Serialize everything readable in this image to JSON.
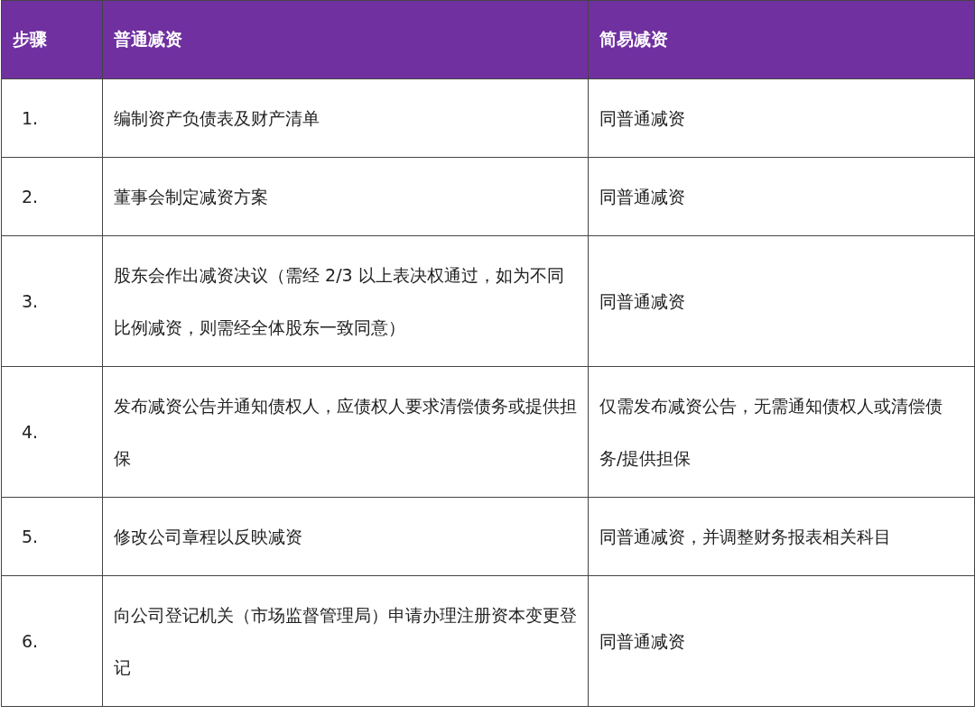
{
  "table": {
    "columns": [
      "步骤",
      "普通减资",
      "简易减资"
    ],
    "rows": [
      {
        "cells": [
          "1.",
          "编制资产负债表及财产清单",
          "同普通减资"
        ]
      },
      {
        "cells": [
          "2.",
          "董事会制定减资方案",
          "同普通减资"
        ]
      },
      {
        "cells": [
          "3.",
          "股东会作出减资决议（需经 2/3 以上表决权通过，如为不同比例减资，则需经全体股东一致同意）",
          "同普通减资"
        ]
      },
      {
        "cells": [
          "4.",
          "发布减资公告并通知债权人，应债权人要求清偿债务或提供担保",
          "仅需发布减资公告，无需通知债权人或清偿债务/提供担保"
        ]
      },
      {
        "cells": [
          "5.",
          "修改公司章程以反映减资",
          "同普通减资，并调整财务报表相关科目"
        ]
      },
      {
        "cells": [
          "6.",
          "向公司登记机关（市场监督管理局）申请办理注册资本变更登记",
          "同普通减资"
        ]
      }
    ]
  }
}
